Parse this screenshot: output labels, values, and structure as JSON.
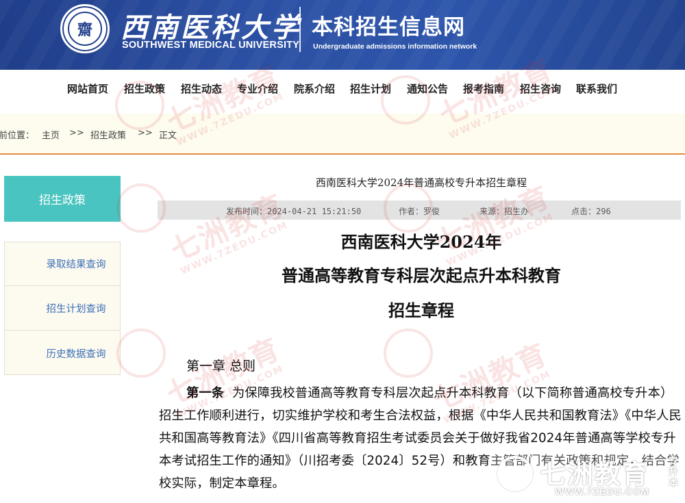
{
  "header": {
    "seal_glyph": "齋",
    "university_cn": "西南医科大学",
    "university_en": "SOUTHWEST MEDICAL UNIVERSITY",
    "site_cn": "本科招生信息网",
    "site_en": "Undergraduate admissions information network"
  },
  "nav": {
    "items": [
      "网站首页",
      "招生政策",
      "招生动态",
      "专业介绍",
      "院系介绍",
      "招生计划",
      "通知公告",
      "报考指南",
      "招生咨询",
      "联系我们"
    ]
  },
  "breadcrumb": {
    "prefix": "前位置：",
    "home": "主页",
    "sep": ">>",
    "section": "招生政策",
    "current": "正文"
  },
  "sidebar": {
    "title": "招生政策",
    "links": [
      "录取结果查询",
      "招生计划查询",
      "历史数据查询"
    ]
  },
  "article": {
    "title": "西南医科大学2024年普通高校专升本招生章程",
    "meta": {
      "published": "发布时间：2024-04-21 15:21:50",
      "author": "作者：罗俊",
      "source": "来源：招生办",
      "clicks": "点击：296"
    },
    "heading_lines": [
      "西南医科大学2024年",
      "普通高等教育专科层次起点升本科教育",
      "招生章程"
    ],
    "chapter": "第一章  总则",
    "article1_label": "第一条",
    "article1_text": "为保障我校普通高等教育专科层次起点升本科教育（以下简称普通高校专升本）招生工作顺利进行，切实维护学校和考生合法权益，根据《中华人民共和国教育法》《中华人民共和国高等教育法》《四川省高等教育招生考试委员会关于做好我省2024年普通高等学校专升本考试招生工作的通知》（川招考委〔2024〕52号）和教育主管部门有关政策和规定，结合学校实际，制定本章程。"
  },
  "watermark": {
    "brand": "七洲教育",
    "url": "WWW.7ZEDU.COM",
    "tag": "专升本"
  },
  "corner_logo": {
    "brand": "七洲教育",
    "url": "WWW.7ZEDU.COM",
    "tag": "专升本"
  },
  "colors": {
    "banner": "#2b4fa2",
    "sidebar_title": "#4ac4c0",
    "breadcrumb_bg": "#fdfcef",
    "accent_line": "#e38a3b",
    "link": "#3a6fb5",
    "watermark": "#d72828"
  }
}
